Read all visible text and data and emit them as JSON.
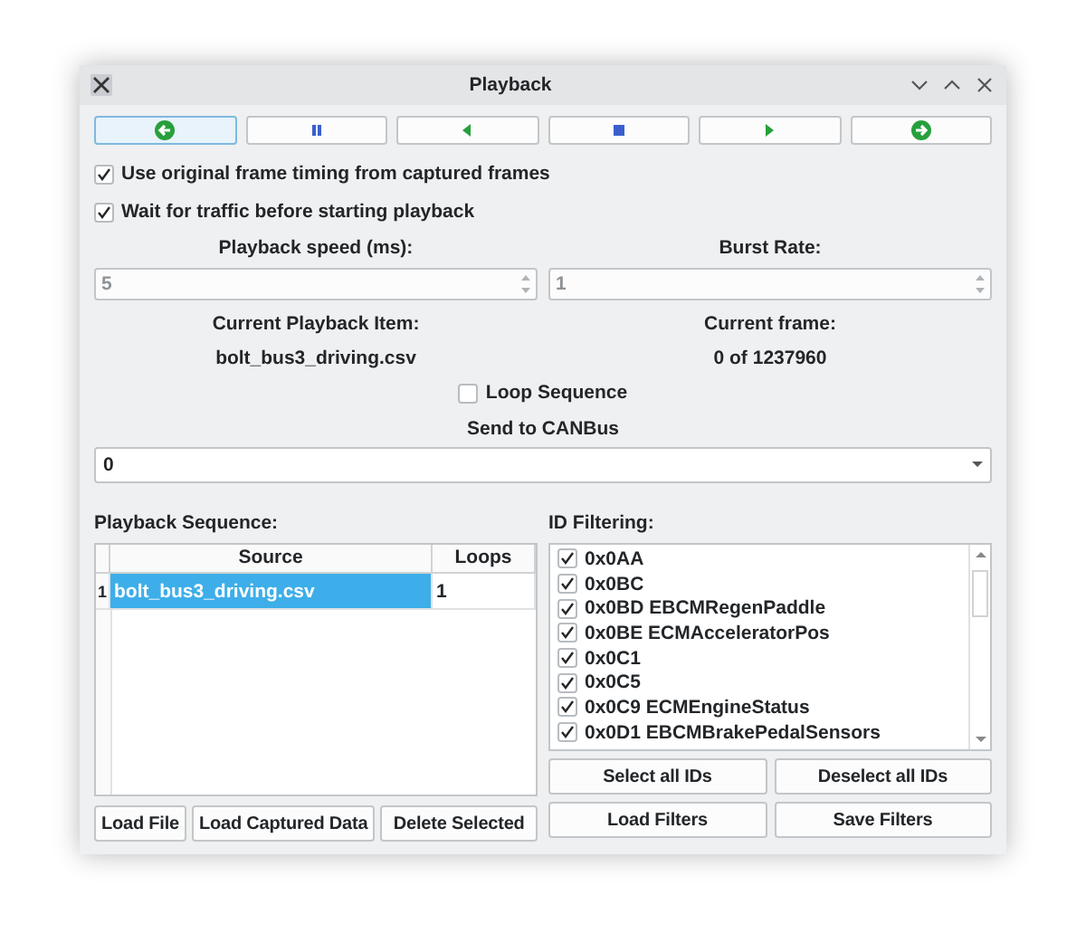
{
  "window": {
    "title": "Playback"
  },
  "transport": [
    {
      "kind": "circle-left",
      "focused": true
    },
    {
      "kind": "pause",
      "focused": false
    },
    {
      "kind": "triangle-left",
      "focused": false
    },
    {
      "kind": "stop",
      "focused": false
    },
    {
      "kind": "triangle-right",
      "focused": false
    },
    {
      "kind": "circle-right",
      "focused": false
    }
  ],
  "options": [
    {
      "label": "Use original frame timing from captured frames",
      "checked": true
    },
    {
      "label": "Wait for traffic before starting playback",
      "checked": true
    }
  ],
  "speed": {
    "label": "Playback speed (ms):",
    "value": "5"
  },
  "burst": {
    "label": "Burst Rate:",
    "value": "1"
  },
  "current_item": {
    "label": "Current Playback Item:",
    "value": "bolt_bus3_driving.csv"
  },
  "current_frame": {
    "label": "Current frame:",
    "value": "0 of 1237960"
  },
  "loop": {
    "label": "Loop Sequence",
    "checked": false
  },
  "send": {
    "label": "Send to CANBus",
    "value": "0"
  },
  "sequence": {
    "label": "Playback Sequence:",
    "columns": [
      "Source",
      "Loops"
    ],
    "rows": [
      {
        "index": "1",
        "source": "bolt_bus3_driving.csv",
        "loops": "1",
        "selected": true
      }
    ]
  },
  "filtering": {
    "label": "ID Filtering:",
    "items": [
      {
        "label": "0x0AA",
        "checked": true
      },
      {
        "label": "0x0BC",
        "checked": true
      },
      {
        "label": "0x0BD EBCMRegenPaddle",
        "checked": true
      },
      {
        "label": "0x0BE ECMAcceleratorPos",
        "checked": true
      },
      {
        "label": "0x0C1",
        "checked": true
      },
      {
        "label": "0x0C5",
        "checked": true
      },
      {
        "label": "0x0C9 ECMEngineStatus",
        "checked": true
      },
      {
        "label": "0x0D1 EBCMBrakePedalSensors",
        "checked": true
      }
    ]
  },
  "sequence_buttons": [
    "Load File",
    "Load Captured Data",
    "Delete Selected"
  ],
  "filter_buttons": [
    "Select all IDs",
    "Deselect all IDs",
    "Load Filters",
    "Save Filters"
  ]
}
